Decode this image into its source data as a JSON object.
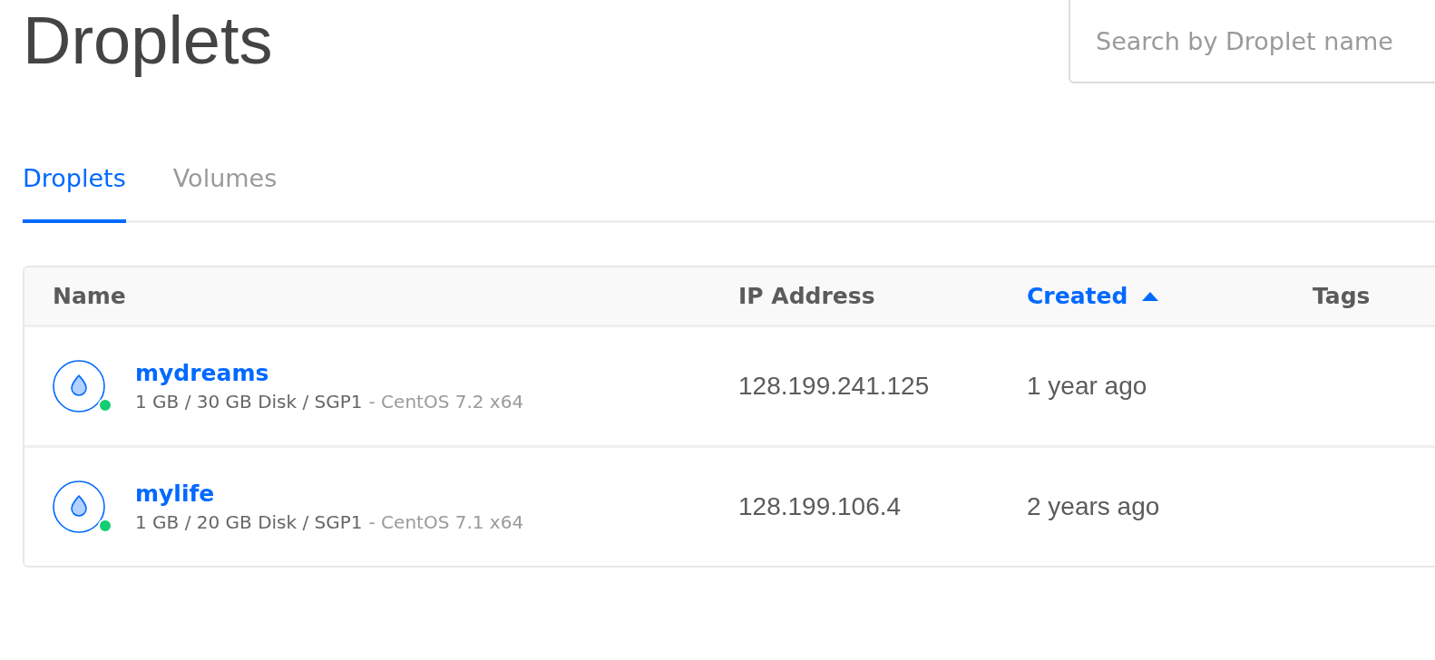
{
  "page": {
    "title": "Droplets"
  },
  "search": {
    "placeholder": "Search by Droplet name"
  },
  "tabs": [
    {
      "label": "Droplets",
      "selected": true
    },
    {
      "label": "Volumes",
      "selected": false
    }
  ],
  "table": {
    "columns": [
      {
        "label": "Name",
        "sorted": false
      },
      {
        "label": "IP Address",
        "sorted": false
      },
      {
        "label": "Created",
        "sorted": true
      },
      {
        "label": "Tags",
        "sorted": false
      }
    ],
    "rows": [
      {
        "name": "mydreams",
        "specs": "1 GB / 30 GB Disk / SGP1",
        "image": "- CentOS 7.2 x64",
        "ip": "128.199.241.125",
        "created": "1 year ago",
        "on": true
      },
      {
        "name": "mylife",
        "specs": "1 GB / 20 GB Disk / SGP1",
        "image": "- CentOS 7.1 x64",
        "ip": "128.199.106.4",
        "created": "2 years ago",
        "on": true
      }
    ]
  }
}
